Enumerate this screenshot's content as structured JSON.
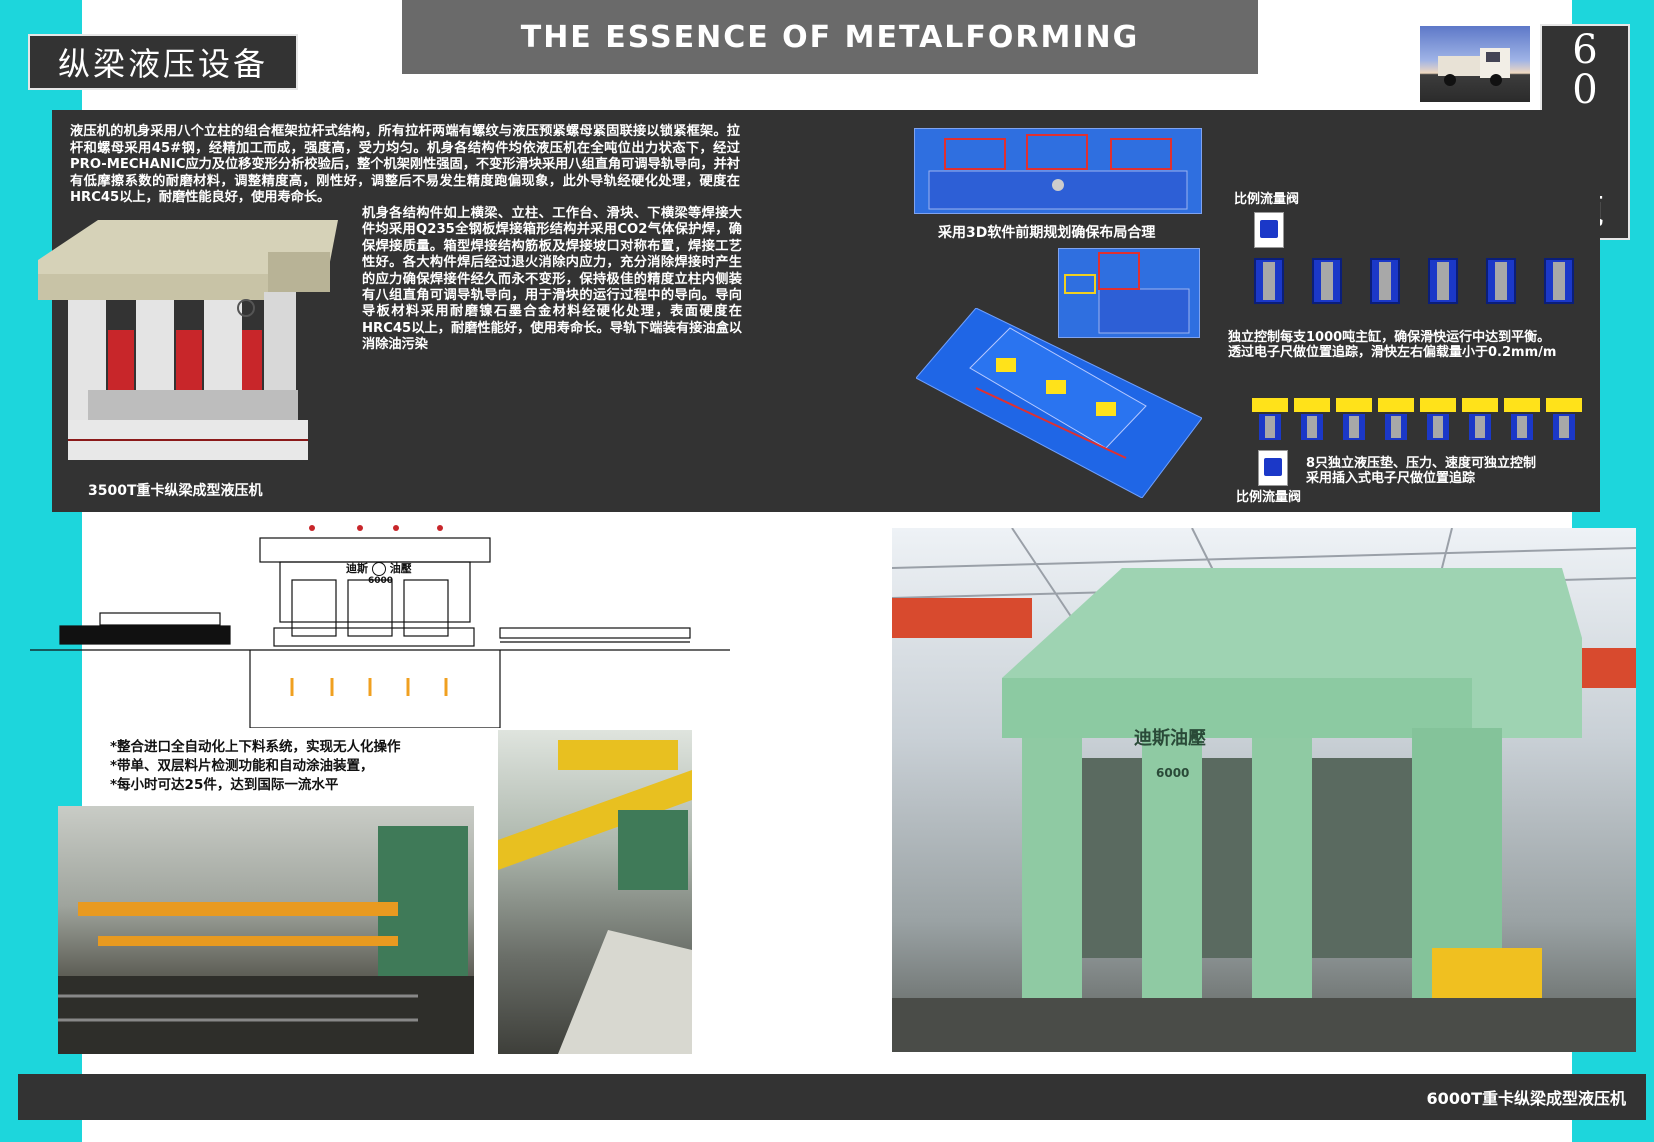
{
  "header": {
    "title": "纵梁液压设备",
    "banner": "THE ESSENCE OF METALFORMING",
    "tonnage_chars": [
      "6",
      "0",
      "0",
      "0",
      "吨"
    ]
  },
  "intro": {
    "para1": "液压机的机身采用八个立柱的组合框架拉杆式结构，所有拉杆两端有螺纹与液压预紧螺母紧固联接以锁紧框架。拉杆和螺母采用45#钢，经精加工而成，强度高，受力均匀。机身各结构件均依液压机在全吨位出力状态下，经过PRO-MECHANIC应力及位移变形分析校验后，整个机架刚性强固，不变形滑块采用八组直角可调导轨导向，并衬有低摩擦系数的耐磨材料，调整精度高，刚性好，调整后不易发生精度跑偏现象，此外导轨经硬化处理，硬度在HRC45以上，耐磨性能良好，使用寿命长。",
    "para2": "机身各结构件如上横梁、立柱、工作台、滑块、下横梁等焊接大件均采用Q235全钢板焊接箱形结构并采用CO2气体保护焊，确保焊接质量。箱型焊接结构筋板及焊接坡口对称布置，焊接工艺性好。各大构件焊后经过退火消除内应力，充分消除焊接时产生的应力确保焊接件经久而永不变形，保持极佳的精度立柱内侧装有八组直角可调导轨导向，用于滑块的运行过程中的导向。导向导板材料采用耐磨镍石墨合金材料经硬化处理，表面硬度在HRC45以上，耐磨性能好，使用寿命长。导轨下端装有接油盒以消除油污染",
    "press_caption": "3500T重卡纵梁成型液压机"
  },
  "layout3d": {
    "caption": "采用3D软件前期规划确保布局合理"
  },
  "hydraulics": {
    "valve_label_top": "比例流量阀",
    "cylinder_note_1": "独立控制每支1000吨主缸，确保滑快运行中达到平衡。",
    "cylinder_note_2": "透过电子尺做位置追踪，滑快左右偏载量小于0.2mm/m",
    "pad_note_1": "8只独立液压垫、压力、速度可独立控制",
    "pad_note_2": "采用插入式电子尺做位置追踪",
    "valve_label_bottom": "比例流量阀"
  },
  "drawing": {
    "logo_text": "迪斯",
    "logo_text2": "油壓",
    "model": "6000"
  },
  "bullets": [
    "*整合进口全自动化上下料系统，实现无人化操作",
    "*带单、双层料片检测功能和自动涂油装置，",
    "*每小时可达25件，达到国际一流水平"
  ],
  "big_photo": {
    "brand": "迪斯油壓",
    "model": "6000"
  },
  "footer": {
    "caption": "6000T重卡纵梁成型液压机"
  }
}
